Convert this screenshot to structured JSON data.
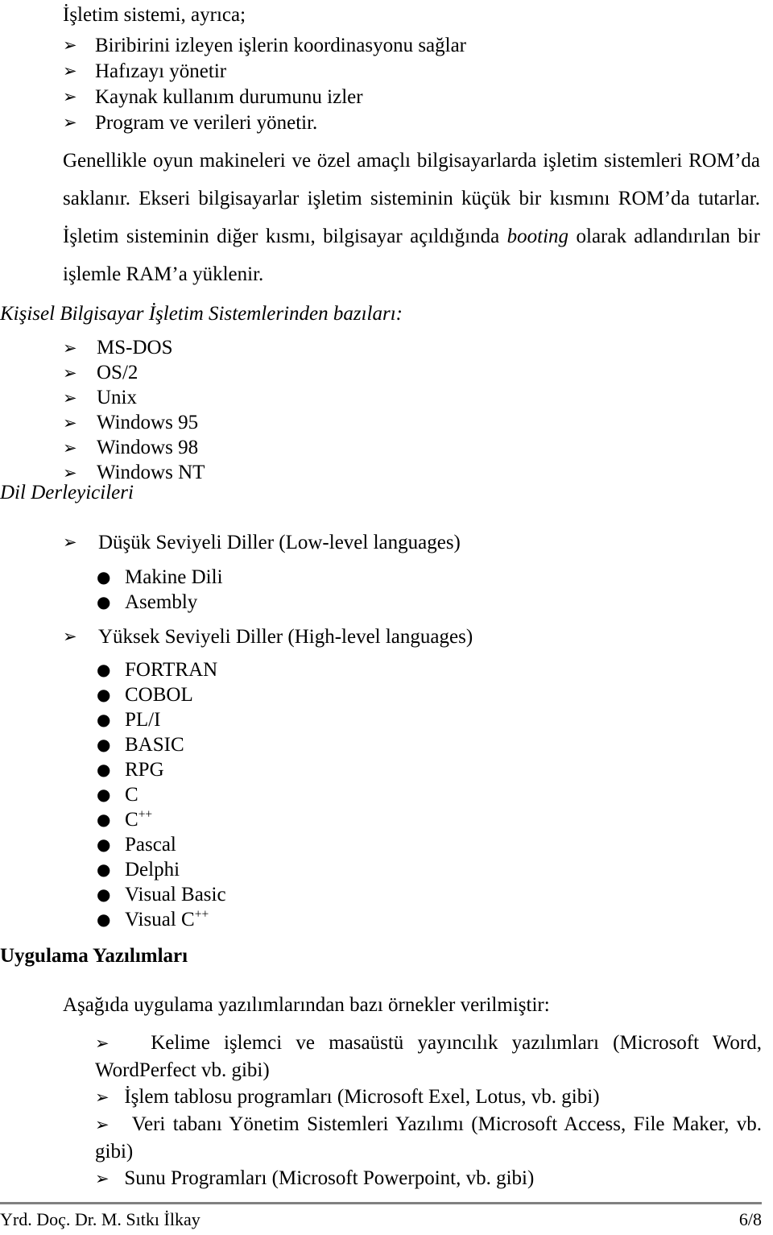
{
  "document": {
    "intro_line": "İşletim sistemi, ayrıca;",
    "os_functions": [
      "Biribirini izleyen işlerin koordinasyonu sağlar",
      "Hafızayı yönetir",
      "Kaynak kullanım durumunu izler",
      "Program ve verileri yönetir."
    ],
    "paragraph": {
      "part1": "Genellikle oyun makineleri ve özel amaçlı bilgisayarlarda işletim sistemleri ROM’da saklanır. Ekseri bilgisayarlar işletim sisteminin küçük bir kısmını ROM’da tutarlar. İşletim sisteminin diğer kısmı, bilgisayar açıldığında ",
      "italic": "booting",
      "part2": " olarak adlandırılan bir işlemle RAM’a yüklenir."
    },
    "os_heading": "Kişisel Bilgisayar İşletim Sistemlerinden bazıları:",
    "os_list": [
      "MS-DOS",
      "OS/2",
      "Unix",
      "Windows 95",
      "Windows 98",
      "Windows NT"
    ],
    "compilers_heading": "Dil Derleyicileri",
    "low_level": {
      "label": "Düşük Seviyeli Diller (Low-level languages)",
      "items": [
        "Makine Dili",
        "Asembly"
      ]
    },
    "high_level": {
      "label": "Yüksek Seviyeli Diller (High-level languages)",
      "items": [
        {
          "base": "FORTRAN",
          "sup": ""
        },
        {
          "base": "COBOL",
          "sup": ""
        },
        {
          "base": "PL/I",
          "sup": ""
        },
        {
          "base": "BASIC",
          "sup": ""
        },
        {
          "base": "RPG",
          "sup": ""
        },
        {
          "base": "C",
          "sup": ""
        },
        {
          "base": "C",
          "sup": "++"
        },
        {
          "base": "Pascal",
          "sup": ""
        },
        {
          "base": "Delphi",
          "sup": ""
        },
        {
          "base": "Visual Basic",
          "sup": ""
        },
        {
          "base": "Visual C",
          "sup": "++"
        }
      ]
    },
    "apps_heading": "Uygulama Yazılımları",
    "apps_intro": "Aşağıda uygulama yazılımlarından bazı örnekler verilmiştir:",
    "apps_list": [
      "Kelime işlemci ve masaüstü yayıncılık yazılımları (Microsoft Word, WordPerfect vb. gibi)",
      "İşlem tablosu programları (Microsoft Exel, Lotus, vb. gibi)",
      "Veri tabanı Yönetim Sistemleri Yazılımı (Microsoft Access, File Maker, vb. gibi)",
      "Sunu Programları (Microsoft Powerpoint, vb. gibi)"
    ],
    "footer": {
      "author": "Yrd. Doç. Dr. M. Sıtkı İlkay",
      "page": "6/8"
    },
    "markers": {
      "arrow": "➢",
      "dot": "●"
    },
    "colors": {
      "text": "#000000",
      "rule": "#808080",
      "background": "#ffffff"
    }
  }
}
